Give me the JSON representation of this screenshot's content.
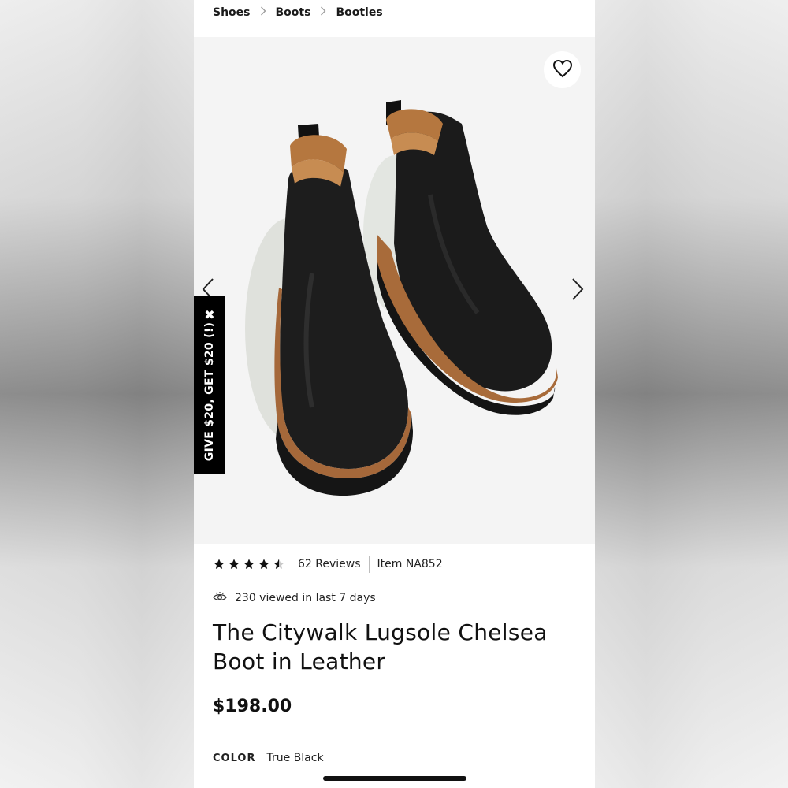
{
  "breadcrumb": {
    "items": [
      "Shoes",
      "Boots",
      "Booties"
    ]
  },
  "promo": {
    "text": "GIVE $20, GET $20 (!)"
  },
  "product": {
    "rating": 4.5,
    "rating_max": 5,
    "reviews": "62 Reviews",
    "item_number": "Item NA852",
    "viewed": "230 viewed in last 7 days",
    "title": "The Citywalk Lugsole Chelsea Boot in Leather",
    "price": "$198.00",
    "color_label": "COLOR",
    "color_value": "True Black"
  },
  "icons": {
    "wishlist": "heart-icon",
    "prev": "chevron-left-icon",
    "next": "chevron-right-icon",
    "close": "close-icon",
    "views": "eye-icon"
  }
}
